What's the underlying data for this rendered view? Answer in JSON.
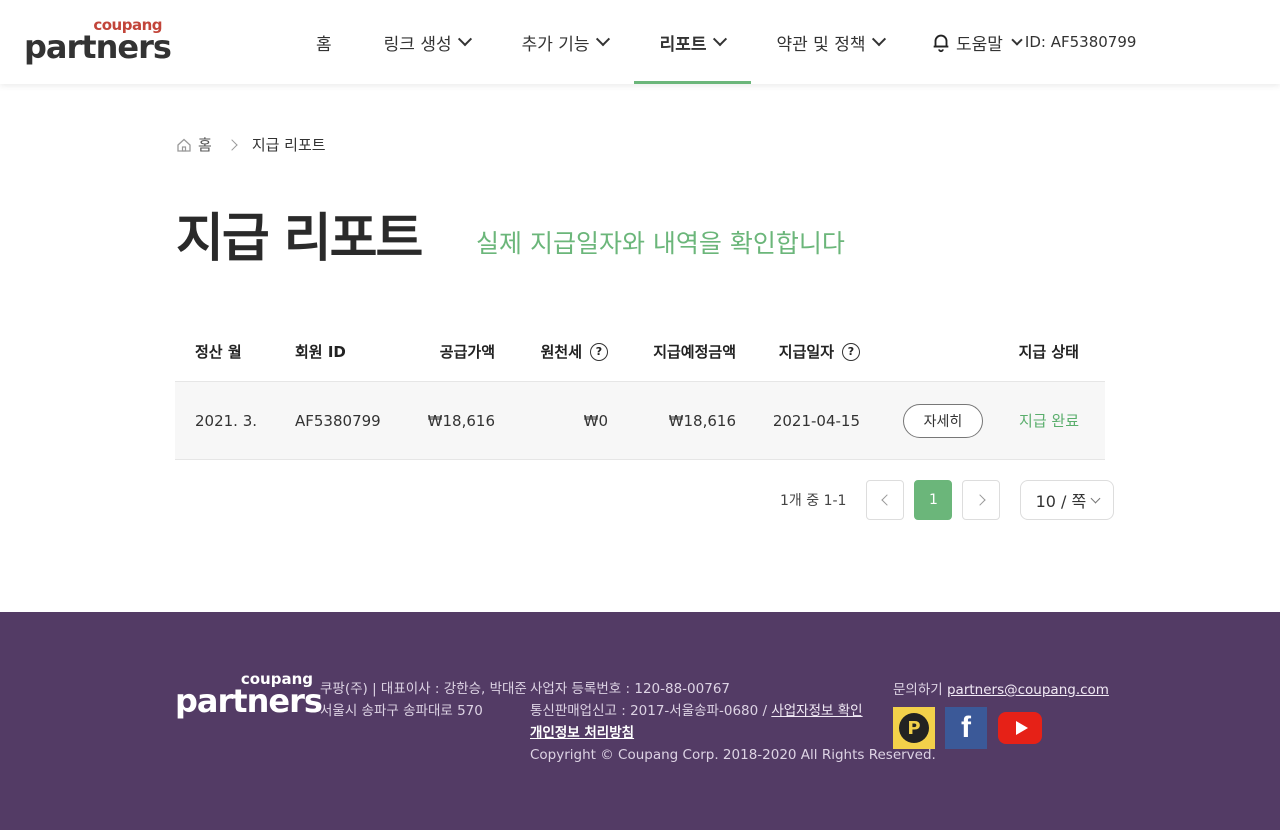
{
  "header": {
    "logo_small": "coupang",
    "logo_big": "partners",
    "nav": [
      {
        "label": "홈",
        "has_dropdown": false,
        "active": false
      },
      {
        "label": "링크 생성",
        "has_dropdown": true,
        "active": false
      },
      {
        "label": "추가 기능",
        "has_dropdown": true,
        "active": false
      },
      {
        "label": "리포트",
        "has_dropdown": true,
        "active": true
      },
      {
        "label": "약관 및 정책",
        "has_dropdown": true,
        "active": false
      }
    ],
    "help_label": "도움말",
    "user_id_label": "ID: AF5380799"
  },
  "breadcrumb": {
    "home": "홈",
    "current": "지급 리포트"
  },
  "page": {
    "title": "지급 리포트",
    "subtitle": "실제 지급일자와 내역을 확인합니다"
  },
  "table": {
    "headers": {
      "month": "정산 월",
      "member_id": "회원 ID",
      "supply_amount": "공급가액",
      "withholding_tax": "원천세",
      "expected_payment": "지급예정금액",
      "payment_date": "지급일자",
      "status": "지급 상태"
    },
    "rows": [
      {
        "month": "2021. 3.",
        "member_id": "AF5380799",
        "supply_amount": "₩18,616",
        "withholding_tax": "₩0",
        "expected_payment": "₩18,616",
        "payment_date": "2021-04-15",
        "detail_label": "자세히",
        "status": "지급 완료"
      }
    ]
  },
  "pagination": {
    "range_text": "1개 중 1-1",
    "current_page": "1",
    "page_size": "10 / 쪽"
  },
  "footer": {
    "logo_small": "coupang",
    "logo_big": "partners",
    "company_line1": "쿠팡(주) | 대표이사 : 강한승, 박대준",
    "company_line2": "서울시 송파구 송파대로 570",
    "biz_reg": "사업자 등록번호 : 120-88-00767",
    "mail_order_prefix": "통신판매업신고 : 2017-서울송파-0680 / ",
    "biz_info_link": "사업자정보 확인",
    "privacy_link": "개인정보 처리방침",
    "copyright": "Copyright © Coupang Corp. 2018-2020 All Rights Reserved.",
    "contact_prefix": "문의하기 ",
    "contact_email": "partners@coupang.com",
    "fb_glyph": "f",
    "cp_glyph": "P"
  },
  "colors": {
    "accent_green": "#6bb67a",
    "footer_bg": "#533b65"
  }
}
